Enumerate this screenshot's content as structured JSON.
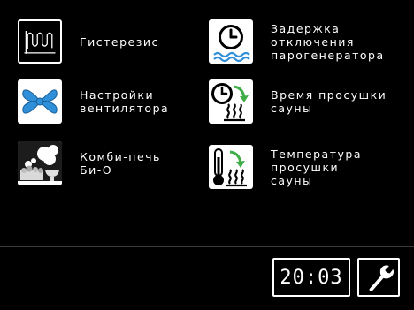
{
  "menu": {
    "hysteresis": {
      "label": "Гистерезис",
      "icon": "hysteresis-wave-icon"
    },
    "steam_delay": {
      "label": "Задержка\nотключения\nпарогенератора",
      "icon": "clock-water-icon"
    },
    "fan_settings": {
      "label": "Настройки\nвентилятора",
      "icon": "fan-icon"
    },
    "drying_time": {
      "label": "Время просушки\nсауны",
      "icon": "clock-heat-arrow-icon"
    },
    "combi_oven": {
      "label": "Комби-печь\nБи-О",
      "icon": "sauna-stove-icon"
    },
    "drying_temp": {
      "label": "Температура\nпросушки\nсауны",
      "icon": "thermometer-heat-arrow-icon"
    }
  },
  "status": {
    "time": "20:03",
    "service_icon": "wrench-icon"
  },
  "colors": {
    "background": "#000000",
    "fan_blue": "#2f8fd8",
    "arrow_green": "#3fae49",
    "water_blue": "#2f8fd8"
  }
}
